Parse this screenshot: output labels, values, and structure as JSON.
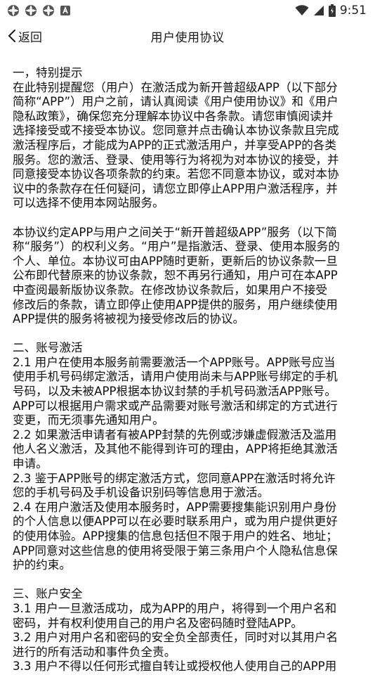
{
  "status_bar": {
    "time": "9:51",
    "left_icons": [
      "app-notification-icon",
      "app-notification-icon",
      "app-notification-icon",
      "a-badge-icon"
    ],
    "right_icons": [
      "wifi-icon",
      "signal-icon",
      "battery-icon"
    ]
  },
  "header": {
    "back_label": "返回",
    "title": "用户使用协议"
  },
  "document": {
    "sections": [
      {
        "lines": [
          "一，特别提示",
          "在此特别提醒您（用户）在激活成为新开普超级APP（以下部分",
          "简称“APP”）用户之前，请认真阅读《用户使用协议》和《用户",
          "隐私政策》，确保您充分理解本协议中各条款。请您审慎阅读并",
          "选择接受或不接受本协议。您同意并点击确认本协议条款且完成",
          "激活程序后，才能成为APP的正式激活用户，并享受APP的各类",
          "服务。您的激活、登录、使用等行为将视为对本协议的接受，并",
          "同意接受本协议各项条款的约束。若您不同意本协议，或对本协",
          "议中的条款存在任何疑问，请您立即停止APP用户激活程序，并",
          "可以选择不使用本网站服务。"
        ]
      },
      {
        "lines": [
          "本协议约定APP与用户之间关于“新开普超级APP”服务（以下简",
          "称“服务”）的权利义务。“用户”是指激活、登录、使用本服务的",
          "个人、单位。本协议可由APP随时更新，更新后的协议条款一旦",
          "公布即代替原来的协议条款，恕不再另行通知，用户可在本APP",
          "中查阅最新版协议条款。在修改协议条款后，如果用户不接受",
          "修改后的条款，请立即停止使用APP提供的服务，用户继续使用",
          "APP提供的服务将被视为接受修改后的协议。"
        ]
      },
      {
        "lines": [
          "二、账号激活",
          "2.1 用户在使用本服务前需要激活一个APP账号。APP账号应当",
          "使用手机号码绑定激活，请用户使用尚未与APP账号绑定的手机",
          "号码，以及未被APP根据本协议封禁的手机号码激活APP账号。",
          "APP可以根据用户需求或产品需要对账号激活和绑定的方式进行",
          "变更，而无须事先通知用户。",
          "2.2 如果激活申请者有被APP封禁的先例或涉嫌虚假激活及滥用",
          "他人名义激活，及其他不能得到许可的理由，APP将拒绝其激活",
          "申请。",
          "2.3 鉴于APP账号的绑定激活方式，您同意APP在激活时将允许",
          "您的手机号码及手机设备识别码等信息用于激活。",
          "2.4 在用户激活及使用本服务时，APP需要搜集能识别用户身份",
          "的个人信息以便APP可以在必要时联系用户，或为用户提供更好",
          "的使用体验。APP搜集的信息包括但不限于用户的姓名、地址；",
          "APP同意对这些信息的使用将受限于第三条用户个人隐私信息保",
          "护的约束。"
        ]
      },
      {
        "lines": [
          "三、账户安全",
          "3.1 用户一旦激活成功，成为APP的用户，将得到一个用户名和",
          "密码，并有权利使用自己的用户名及密码随时登陆APP。",
          "3.2 用户对用户名和密码的安全负全部责任，同时对以其用户名",
          "进行的所有活动和事件负全责。",
          "3.3 用户不得以任何形式擅自转让或授权他人使用自己的APP用"
        ]
      }
    ]
  }
}
